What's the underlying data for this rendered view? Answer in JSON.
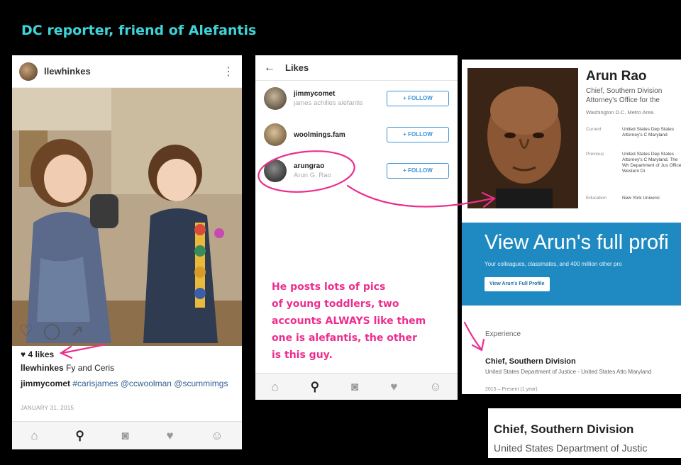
{
  "slide": {
    "title": "DC reporter, friend of Alefantis"
  },
  "post": {
    "username": "llewhinkes",
    "likes_label": "4 likes",
    "caption_user": "llewhinkes",
    "caption_text": "Fy and Ceris",
    "comment_user": "jimmycomet",
    "comment_text": "#carisjames @ccwoolman @scummimgs",
    "date": "JANUARY 31, 2015"
  },
  "likes_screen": {
    "title": "Likes",
    "follow_label": "+ FOLLOW",
    "users": [
      {
        "username": "jimmycomet",
        "full_name": "james achilles alefantis"
      },
      {
        "username": "woolmings.fam",
        "full_name": ""
      },
      {
        "username": "arungrao",
        "full_name": "Arun G. Rao"
      }
    ]
  },
  "annotation": {
    "lines": [
      "He posts lots of pics",
      "of young toddlers, two",
      "accounts ALWAYS like them",
      "one is alefantis, the other",
      "is this guy."
    ]
  },
  "linkedin": {
    "name": "Arun Rao",
    "headline_1": "Chief, Southern Division",
    "headline_2": "Attorney's Office for the",
    "location": "Washington D.C. Metro Area",
    "current_label": "Current",
    "current_value": "United States Dep States Attorney's C Maryland",
    "previous_label": "Previous",
    "previous_value": "United States Dep States Attorney's C Maryland, The Wh Department of Jus Office, Western Di",
    "education_label": "Education",
    "education_value": "New York Universi",
    "banner_heading": "View Arun's full profi",
    "banner_text": "Your colleagues, classmates, and 400 million other pro",
    "banner_button": "View Arun's Full Profile",
    "experience_heading": "Experience",
    "exp_title": "Chief, Southern Division",
    "exp_org": "United States Department of Justice - United States Atto Maryland",
    "exp_date": "2015 – Present (1 year)"
  },
  "zoom": {
    "title": "Chief, Southern Division",
    "org": "United States Department of Justic"
  },
  "colors": {
    "title_cyan": "#3fd4d8",
    "annotation_pink": "#ec2e8e",
    "follow_blue": "#3d93d6",
    "linkedin_blue": "#1f8ac1"
  }
}
